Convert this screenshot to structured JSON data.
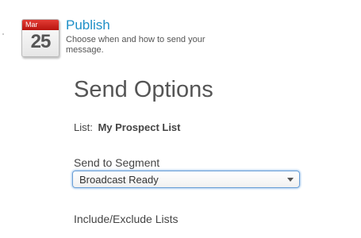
{
  "header": {
    "calendar_month": "Mar",
    "calendar_day": "25",
    "title": "Publish",
    "description": "Choose when and how to send your message."
  },
  "main": {
    "title": "Send Options",
    "list_label": "List:",
    "list_value": "My Prospect List",
    "segment_label": "Send to Segment",
    "segment_selected": "Broadcast Ready",
    "include_exclude_label": "Include/Exclude Lists"
  },
  "colors": {
    "accent_title": "#1e8fc7",
    "calendar_red": "#c8201a",
    "select_focus": "#6a9fd6"
  }
}
